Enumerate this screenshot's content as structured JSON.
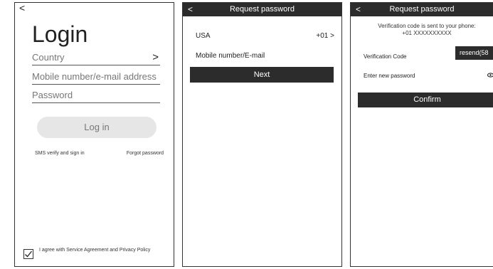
{
  "login": {
    "back_glyph": "<",
    "title": "Login",
    "country_placeholder": "Country",
    "country_chevron": ">",
    "mobile_placeholder": "Mobile number/e-mail address",
    "password_placeholder": "Password",
    "login_button": "Log in",
    "sms_link": "SMS verify and sign in",
    "forgot_link": "Forgot password",
    "agree_checked": true,
    "agree_text": "I agree with Service Agreement and Privacy Policy"
  },
  "request": {
    "back_glyph": "<",
    "title": "Request password",
    "country": "USA",
    "country_code": "+01 >",
    "mobile_label": "Mobile number/E-mail",
    "next_button": "Next"
  },
  "verify": {
    "back_glyph": "<",
    "title": "Request password",
    "notice_line1": "Verification code is sent to your phone:",
    "notice_line2": "+01 XXXXXXXXXX",
    "code_label": "Verification Code",
    "resend_button": "resend(58",
    "new_password_label": "Enter new password",
    "eye_icon": "eye-icon",
    "confirm_button": "Confirm"
  },
  "colors": {
    "header_bg": "#2c2c2c",
    "button_dark": "#2c2c2c",
    "button_light": "#e6e6e6"
  }
}
